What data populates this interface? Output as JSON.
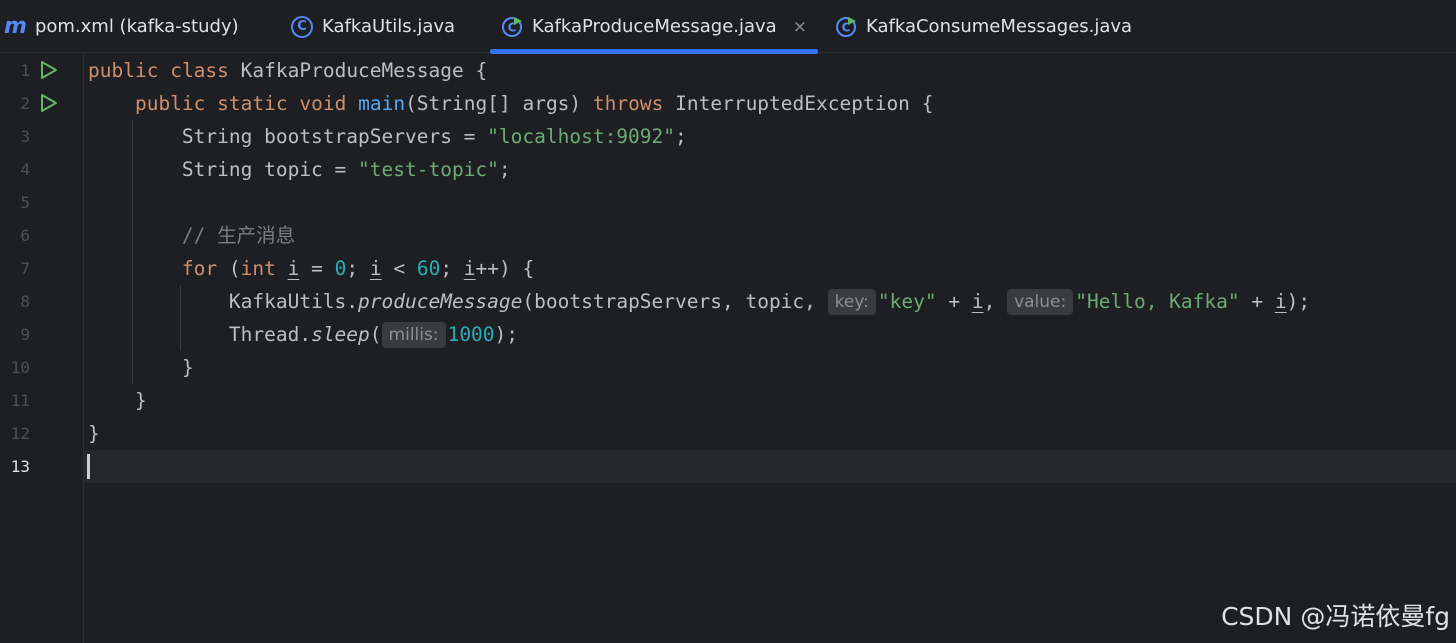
{
  "tabs": [
    {
      "icon": "maven-icon",
      "label": "pom.xml (kafka-study)",
      "active": false
    },
    {
      "icon": "java-class-icon",
      "label": "KafkaUtils.java",
      "active": false
    },
    {
      "icon": "runnable-class-icon",
      "label": "KafkaProduceMessage.java",
      "active": true,
      "closable": true
    },
    {
      "icon": "runnable-class-icon",
      "label": "KafkaConsumeMessages.java",
      "active": false
    }
  ],
  "icons": {
    "maven": "m",
    "class": "C",
    "close": "×"
  },
  "gutter": {
    "line_numbers": [
      "1",
      "2",
      "3",
      "4",
      "5",
      "6",
      "7",
      "8",
      "9",
      "10",
      "11",
      "12",
      "13"
    ],
    "current_line": "13",
    "run_markers_on_lines": [
      "1",
      "2"
    ]
  },
  "code": {
    "l1": {
      "kw1": "public",
      "kw2": "class",
      "name": "KafkaProduceMessage",
      "brace": "{"
    },
    "l2": {
      "kw1": "public",
      "kw2": "static",
      "kw3": "void",
      "method": "main",
      "params": "(String[] args)",
      "kw4": "throws",
      "exception": "InterruptedException",
      "brace": "{"
    },
    "l3": {
      "decl": "String bootstrapServers = ",
      "value": "\"localhost:9092\"",
      "end": ";"
    },
    "l4": {
      "decl": "String topic = ",
      "value": "\"test-topic\"",
      "end": ";"
    },
    "l6": {
      "comment": "// 生产消息"
    },
    "l7": {
      "kw_for": "for",
      "open": " (",
      "kw_int": "int",
      "var1": "i",
      "eq": " = ",
      "zero": "0",
      "semi1": "; ",
      "var2": "i",
      "lt": " < ",
      "sixty": "60",
      "semi2": "; ",
      "var3": "i",
      "tail": "++) {"
    },
    "l8": {
      "cls": "KafkaUtils.",
      "method": "produceMessage",
      "args": "(bootstrapServers, topic, ",
      "hint_key": "key:",
      "key_str": "\"key\"",
      "plus1": " + ",
      "var1": "i",
      "comma": ", ",
      "hint_value": "value:",
      "val_str": "\"Hello, Kafka\"",
      "plus2": " + ",
      "var2": "i",
      "end": ");"
    },
    "l9": {
      "cls": "Thread.",
      "method": "sleep",
      "open": "(",
      "hint_millis": "millis:",
      "num": "1000",
      "end": ");"
    },
    "l10": {
      "brace": "}"
    },
    "l11": {
      "brace": "}"
    },
    "l12": {
      "brace": "}"
    }
  },
  "watermark": "CSDN @冯诺依曼fg",
  "colors": {
    "background": "#1e1f22",
    "keyword": "#cf8e6d",
    "method_declaration": "#56a8f5",
    "string": "#6aab73",
    "number": "#2aacb8",
    "comment": "#7a7e85",
    "active_tab_underline": "#3574f0"
  }
}
